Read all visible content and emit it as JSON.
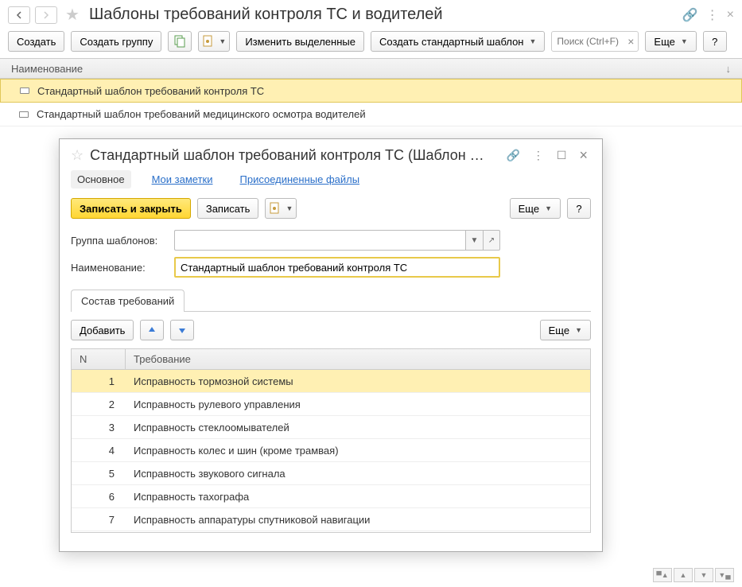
{
  "header": {
    "title": "Шаблоны требований контроля ТС и водителей"
  },
  "cmdbar": {
    "create": "Создать",
    "create_group": "Создать группу",
    "edit_selected": "Изменить выделенные",
    "create_std_template": "Создать стандартный шаблон",
    "search_placeholder": "Поиск (Ctrl+F)",
    "more": "Еще"
  },
  "list": {
    "header_name": "Наименование",
    "rows": [
      "Стандартный шаблон требований контроля ТС",
      "Стандартный шаблон требований медицинского осмотра водителей"
    ]
  },
  "dialog": {
    "title": "Стандартный шаблон требований контроля ТС (Шаблон …",
    "tabs": {
      "main": "Основное",
      "notes": "Мои заметки",
      "files": "Присоединенные файлы"
    },
    "btn_save_close": "Записать и закрыть",
    "btn_save": "Записать",
    "btn_more": "Еще",
    "lbl_group": "Группа шаблонов:",
    "lbl_name": "Наименование:",
    "val_name": "Стандартный шаблон требований контроля ТС",
    "tab_requirements": "Состав требований",
    "btn_add": "Добавить",
    "th_n": "N",
    "th_req": "Требование",
    "rows": [
      {
        "n": "1",
        "t": "Исправность тормозной системы"
      },
      {
        "n": "2",
        "t": "Исправность рулевого управления"
      },
      {
        "n": "3",
        "t": "Исправность стеклоомывателей"
      },
      {
        "n": "4",
        "t": "Исправность колес и шин (кроме трамвая)"
      },
      {
        "n": "5",
        "t": "Исправность звукового сигнала"
      },
      {
        "n": "6",
        "t": "Исправность тахографа"
      },
      {
        "n": "7",
        "t": "Исправность аппаратуры спутниковой навигации"
      }
    ]
  }
}
